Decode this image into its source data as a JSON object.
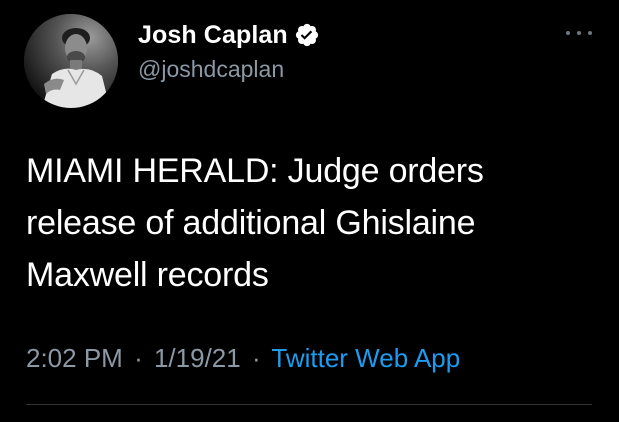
{
  "tweet": {
    "author": {
      "display_name": "Josh Caplan",
      "handle": "@joshdcaplan",
      "avatar_icon": "profile-photo",
      "verified_icon": "verified-badge-icon"
    },
    "more_icon": "more-options-icon",
    "text_lines": [
      "MIAMI HERALD: Judge orders",
      "release of additional Ghislaine",
      "Maxwell records"
    ],
    "time": "2:02 PM",
    "date": "1/19/21",
    "separator": "·",
    "source": "Twitter Web App"
  },
  "colors": {
    "background": "#000000",
    "primary_text": "#ffffff",
    "secondary_text": "#8b98a5",
    "link": "#1d9bf0",
    "divider": "#2f3336"
  }
}
